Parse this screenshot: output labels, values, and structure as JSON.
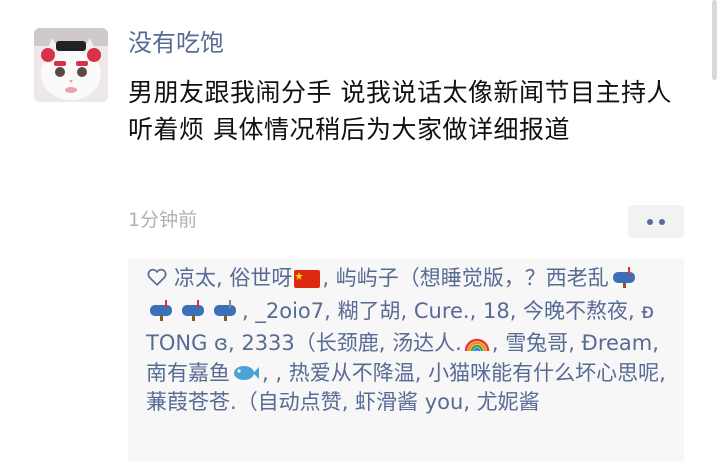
{
  "post": {
    "author": "没有吃饱",
    "content": "男朋友跟我闹分手 说我说话太像新闻节目主持人 听着烦 具体情况稍后为大家做详细报道",
    "time": "1分钟前"
  },
  "likes": {
    "names": [
      "凉太",
      "俗世呀",
      "屿屿子（想睡觉版，？西老乱",
      "_2oio7",
      "糊了胡",
      "Cure.",
      "18",
      "今晚不熬夜",
      "ᴆ TONG ɞ",
      "2333（长颈鹿",
      "汤达人.",
      "雪兔哥",
      "Ɖream",
      "南有嘉鱼",
      "",
      "热爱从不降温",
      "小猫咪能有什么坏心思呢",
      "蒹葭苍苍.",
      "（自动点赞",
      "虾滑酱 you",
      "尤妮酱"
    ]
  },
  "colors": {
    "link": "#576b95",
    "text": "#111111",
    "time": "#b2b2b2",
    "box": "#f7f7f7"
  },
  "icons": [
    "heart-icon",
    "china-flag-icon",
    "mailbox-icon",
    "rainbow-icon",
    "fish-icon",
    "more-dots-icon"
  ]
}
